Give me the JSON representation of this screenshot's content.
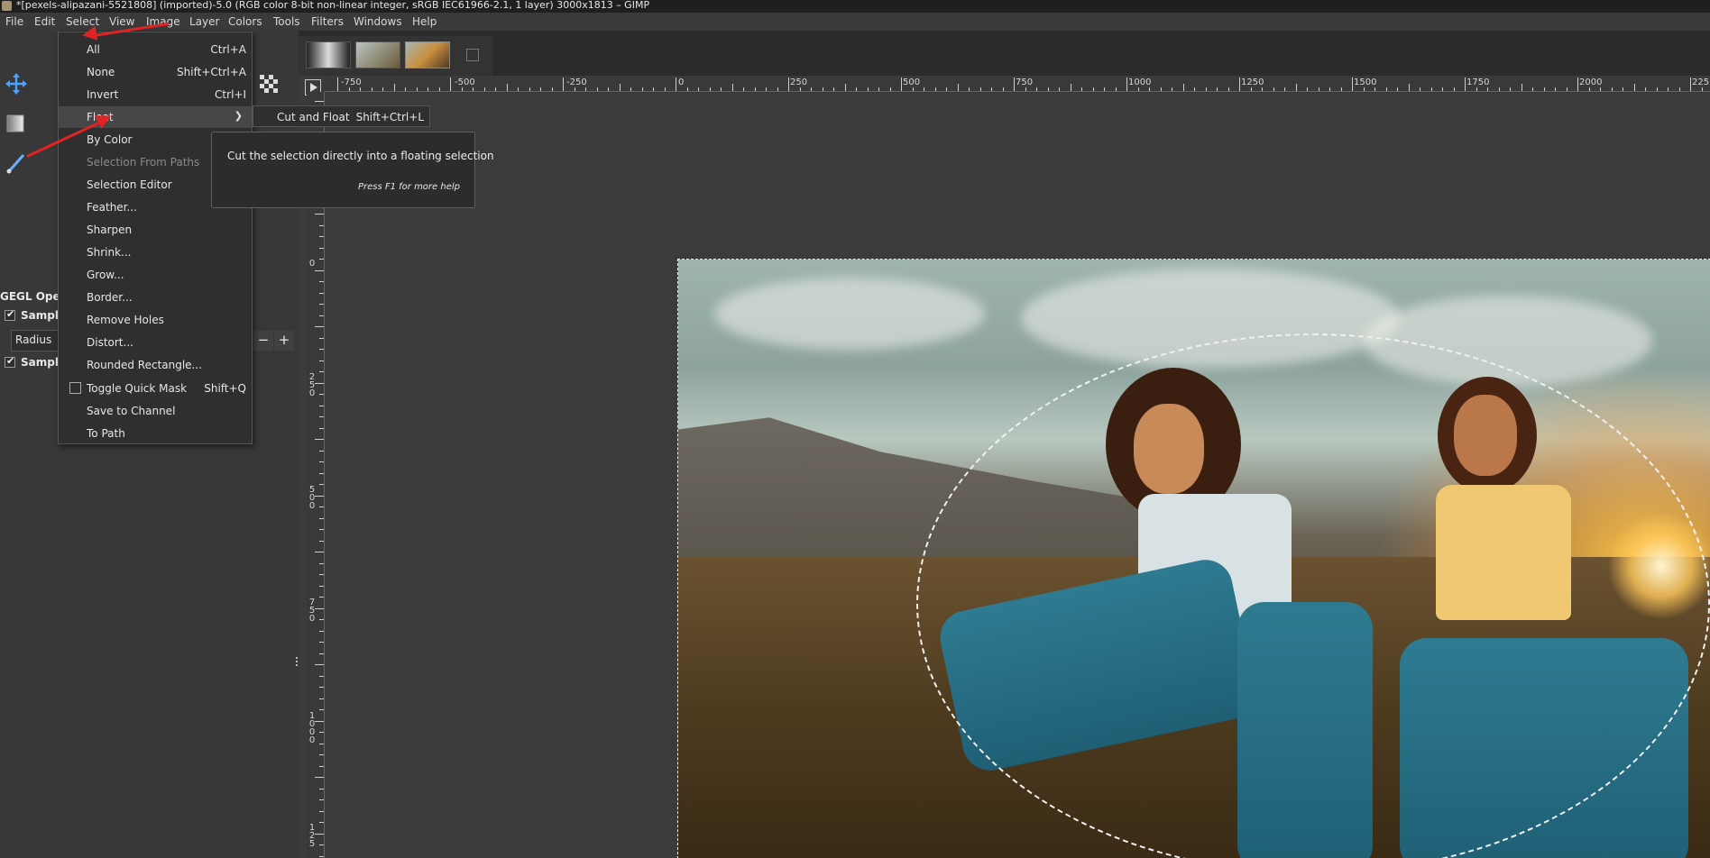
{
  "window": {
    "title": "*[pexels-alipazani-5521808] (imported)-5.0 (RGB color 8-bit non-linear integer, sRGB IEC61966-2.1, 1 layer) 3000x1813 – GIMP"
  },
  "menubar": {
    "items": [
      "File",
      "Edit",
      "Select",
      "View",
      "Image",
      "Layer",
      "Colors",
      "Tools",
      "Filters",
      "Windows",
      "Help"
    ]
  },
  "select_menu": {
    "items": [
      {
        "label": "All",
        "shortcut": "Ctrl+A"
      },
      {
        "label": "None",
        "shortcut": "Shift+Ctrl+A"
      },
      {
        "label": "Invert",
        "shortcut": "Ctrl+I"
      },
      {
        "label": "Float",
        "shortcut": ""
      },
      {
        "label": "By Color",
        "shortcut": ""
      },
      {
        "label": "Selection From Paths",
        "shortcut": ""
      },
      {
        "label": "Selection Editor",
        "shortcut": ""
      },
      {
        "label": "Feather...",
        "shortcut": ""
      },
      {
        "label": "Sharpen",
        "shortcut": ""
      },
      {
        "label": "Shrink...",
        "shortcut": ""
      },
      {
        "label": "Grow...",
        "shortcut": ""
      },
      {
        "label": "Border...",
        "shortcut": ""
      },
      {
        "label": "Remove Holes",
        "shortcut": ""
      },
      {
        "label": "Distort...",
        "shortcut": ""
      },
      {
        "label": "Rounded Rectangle...",
        "shortcut": ""
      },
      {
        "label": "Toggle Quick Mask",
        "shortcut": "Shift+Q"
      },
      {
        "label": "Save to Channel",
        "shortcut": ""
      },
      {
        "label": "To Path",
        "shortcut": ""
      }
    ]
  },
  "float_submenu": {
    "label": "Cut and Float",
    "shortcut": "Shift+Ctrl+L"
  },
  "tooltip": {
    "text": "Cut the selection directly into a floating selection",
    "help": "Press F1 for more help"
  },
  "tool_options": {
    "title": "GEGL Operat",
    "sample_merged": "Sample",
    "radius_label": "Radius",
    "sample_average": "Sample"
  },
  "rulers": {
    "horizontal": [
      "-750",
      "-500",
      "-250",
      "0",
      "250",
      "500",
      "750",
      "1000",
      "1250",
      "1500",
      "1750",
      "2000",
      "225"
    ],
    "vertical": [
      "0",
      "250",
      "500",
      "750",
      "1000",
      "125"
    ]
  },
  "colors": {
    "annotation": "#e02424",
    "menu_bg": "#2f2f2f",
    "highlight": "#474747"
  }
}
